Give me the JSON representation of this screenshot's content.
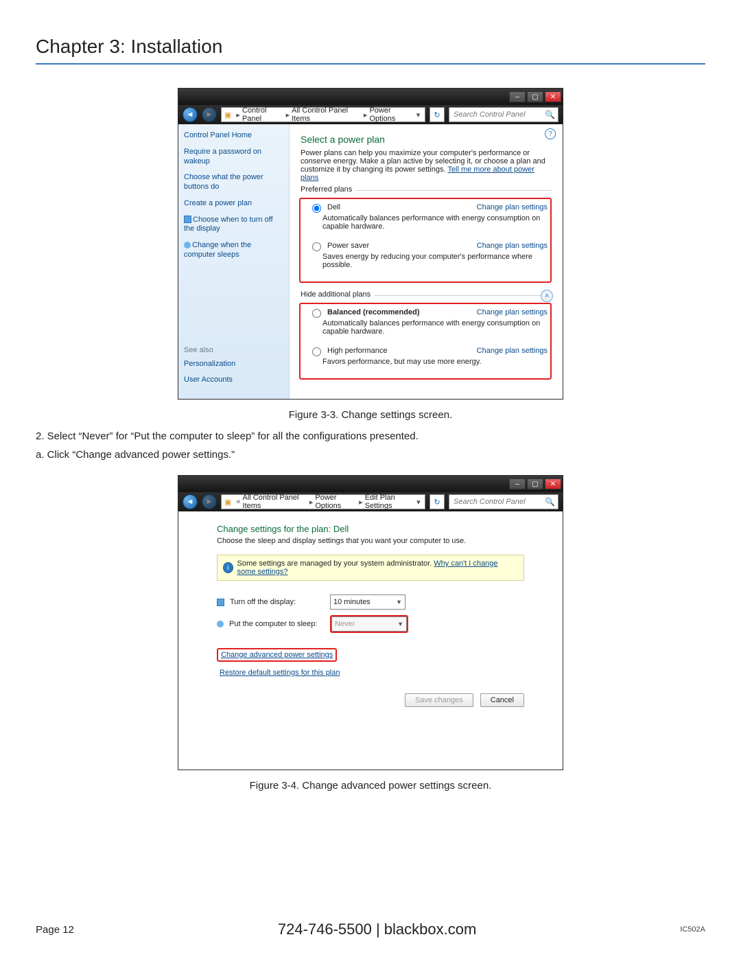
{
  "doc": {
    "chapter": "Chapter 3: Installation",
    "fig3": "Figure 3-3. Change settings screen.",
    "step2": "2. Select “Never” for “Put the computer to sleep” for all the configurations presented.",
    "step2a": "a. Click “Change advanced power settings.”",
    "fig4": "Figure 3-4. Change advanced power settings screen.",
    "page": "Page 12",
    "phone": "724-746-5500   |   blackbox.com",
    "model": "IC502A"
  },
  "s1": {
    "bc": [
      "Control Panel",
      "All Control Panel Items",
      "Power Options"
    ],
    "search_ph": "Search Control Panel",
    "side": {
      "home": "Control Panel Home",
      "l1": "Require a password on wakeup",
      "l2": "Choose what the power buttons do",
      "l3": "Create a power plan",
      "l4": "Choose when to turn off the display",
      "l5": "Change when the computer sleeps",
      "see": "See also",
      "p": "Personalization",
      "u": "User Accounts"
    },
    "title": "Select a power plan",
    "intro": "Power plans can help you maximize your computer's performance or conserve energy. Make a plan active by selecting it, or choose a plan and customize it by changing its power settings. ",
    "tellmore": "Tell me more about power plans",
    "pref": "Preferred plans",
    "hide": "Hide additional plans",
    "chg": "Change plan settings",
    "plans": {
      "dell": {
        "name": "Dell",
        "desc": "Automatically balances performance with energy consumption on capable hardware."
      },
      "saver": {
        "name": "Power saver",
        "desc": "Saves energy by reducing your computer's performance where possible."
      },
      "bal": {
        "name": "Balanced (recommended)",
        "desc": "Automatically balances performance with energy consumption on capable hardware."
      },
      "high": {
        "name": "High performance",
        "desc": "Favors performance, but may use more energy."
      }
    }
  },
  "s2": {
    "bc": [
      "All Control Panel Items",
      "Power Options",
      "Edit Plan Settings"
    ],
    "search_ph": "Search Control Panel",
    "title": "Change settings for the plan: Dell",
    "sub": "Choose the sleep and display settings that you want your computer to use.",
    "info": "Some settings are managed by your system administrator. ",
    "info_link": "Why can't I change some settings?",
    "f1": {
      "label": "Turn off the display:",
      "val": "10 minutes"
    },
    "f2": {
      "label": "Put the computer to sleep:",
      "val": "Never"
    },
    "adv": "Change advanced power settings",
    "restore": "Restore default settings for this plan",
    "save": "Save changes",
    "cancel": "Cancel"
  }
}
